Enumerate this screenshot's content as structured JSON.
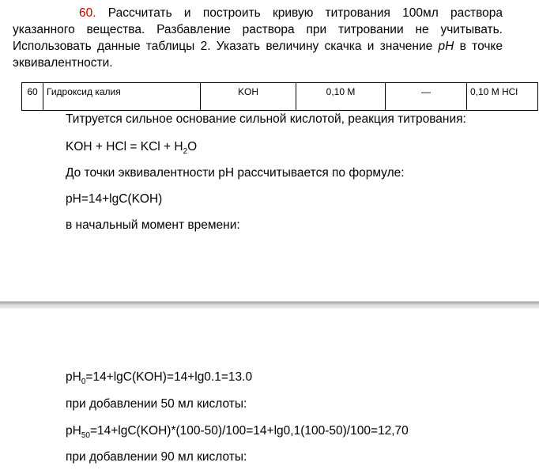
{
  "task": {
    "number": "60.",
    "text": " Рассчитать и построить кривую титрования 100мл раствора указанного вещества. Разбавление раствора при титровании не учитывать. Использовать данные таблицы 2. Указать величину скачка и значение ",
    "ph": "pH",
    "text_end": " в точке эквивалентности."
  },
  "table": {
    "num": "60",
    "name": "Гидроксид калия",
    "formula": "KOH",
    "conc": "0,10 М",
    "dash": "—",
    "titrant": "0,10 М HCl"
  },
  "lines": {
    "l1": "Титруется сильное основание сильной кислотой, реакция титрования:",
    "l2_a": "KOH + HCl = KCl + H",
    "l2_sub": "2",
    "l2_b": "O",
    "l3": "До точки эквивалентности pH рассчитывается по формуле:",
    "l4": "pH=14+lgC(KOH)",
    "l5": "в начальный момент времени:",
    "l6_a": "pH",
    "l6_sub": "0",
    "l6_b": "=14+lgC(KOH)=14+lg0.1=13.0",
    "l7": "при добавлении 50 мл кислоты:",
    "l8_a": "pH",
    "l8_sub": "50",
    "l8_b": "=14+lgC(KOH)*(100-50)/100=14+lg0,1(100-50)/100=12,70",
    "l9": "при добавлении 90 мл кислоты:"
  }
}
